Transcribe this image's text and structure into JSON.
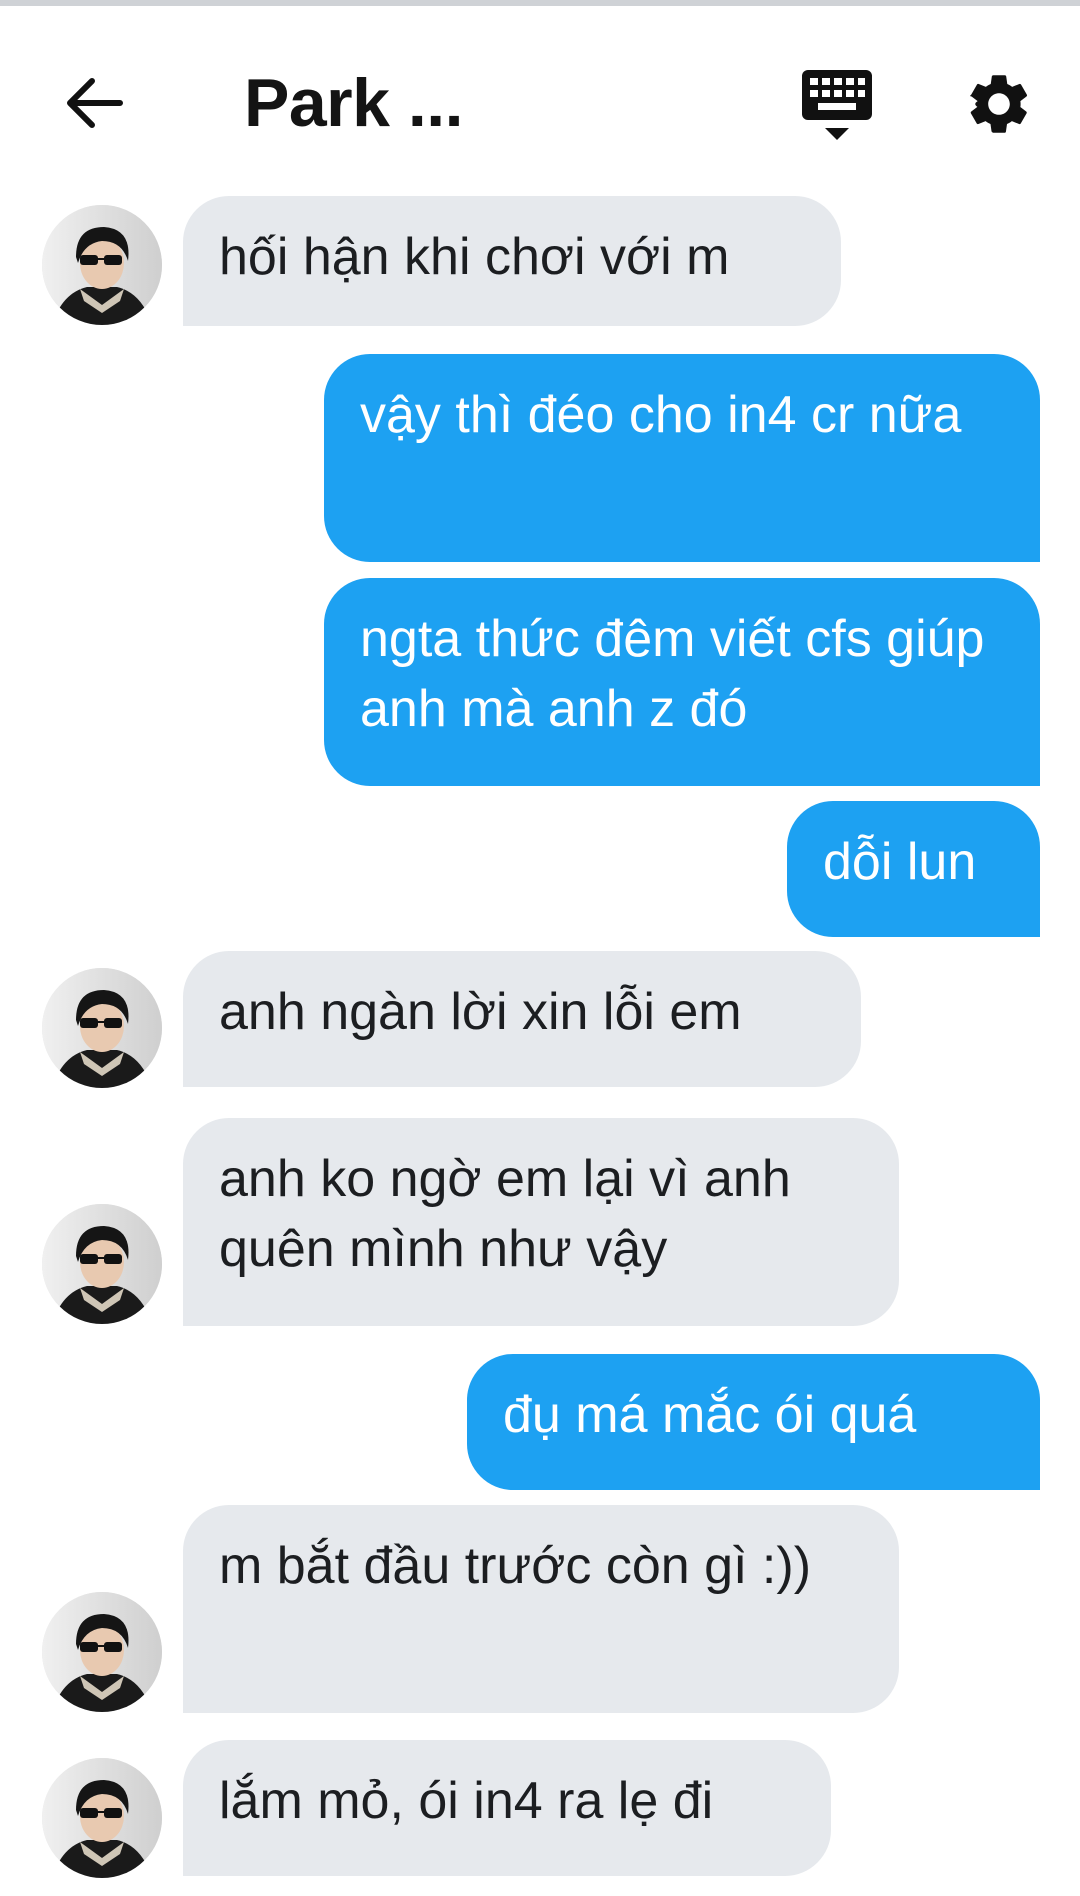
{
  "header": {
    "back_icon": "back-arrow-icon",
    "title": "Park ...",
    "keyboard_icon": "keyboard-icon",
    "settings_icon": "gear-icon"
  },
  "colors": {
    "outgoing_bubble": "#1da1f2",
    "incoming_bubble": "#e6e9ed",
    "text_dark": "#1c1e21"
  },
  "messages": [
    {
      "from": "them",
      "text": "hối hận khi chơi với m"
    },
    {
      "from": "me",
      "text": "vậy thì đéo cho in4 cr nữa"
    },
    {
      "from": "me",
      "text": "ngta thức đêm viết cfs giúp anh mà anh z đó"
    },
    {
      "from": "me",
      "text": "dỗi lun"
    },
    {
      "from": "them",
      "text": "anh ngàn lời xin lỗi em"
    },
    {
      "from": "them",
      "text": "anh ko ngờ em lại vì anh quên mình như vậy"
    },
    {
      "from": "me",
      "text": "đụ má mắc ói quá"
    },
    {
      "from": "them",
      "text": "m bắt đầu trước còn gì :))"
    },
    {
      "from": "them",
      "text": "lắm mỏ, ói in4 ra lẹ đi"
    }
  ]
}
